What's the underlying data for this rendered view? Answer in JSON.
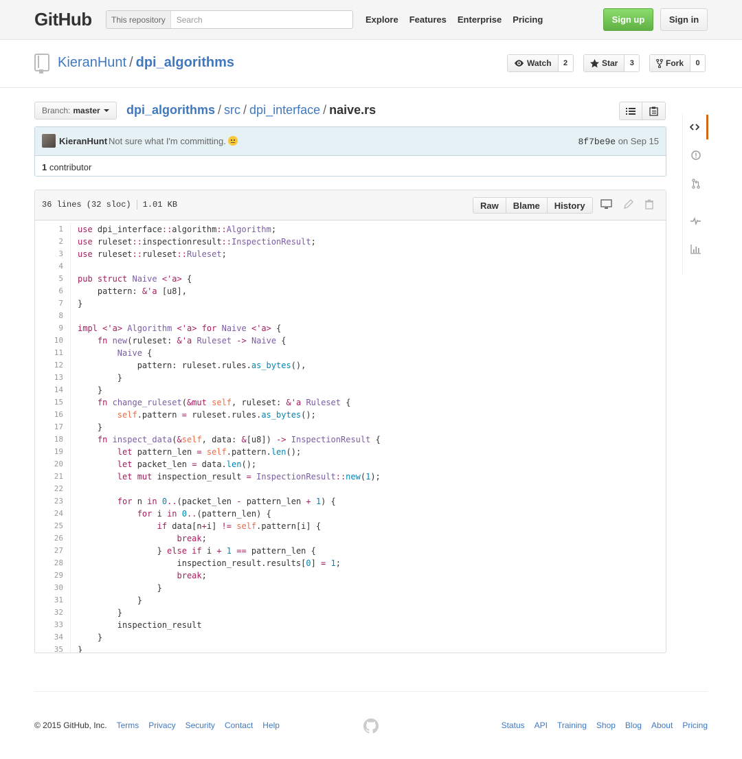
{
  "header": {
    "logo": "GitHub",
    "search_scope": "This repository",
    "search_placeholder": "Search",
    "nav": [
      "Explore",
      "Features",
      "Enterprise",
      "Pricing"
    ],
    "signup": "Sign up",
    "signin": "Sign in"
  },
  "repo": {
    "owner": "KieranHunt",
    "separator": "/",
    "name": "dpi_algorithms",
    "watch_label": "Watch",
    "watch_count": "2",
    "star_label": "Star",
    "star_count": "3",
    "fork_label": "Fork",
    "fork_count": "0"
  },
  "file_nav": {
    "branch_label": "Branch:",
    "branch": "master",
    "breadcrumb": [
      "dpi_algorithms",
      "src",
      "dpi_interface"
    ],
    "filename": "naive.rs"
  },
  "commit": {
    "author": "KieranHunt",
    "message": "Not sure what I'm committing.",
    "sha": "8f7be9e",
    "date_prefix": "on",
    "date": "Sep 15",
    "contributors_count": "1",
    "contributors_label": "contributor"
  },
  "file": {
    "lines_info": "36 lines (32 sloc)",
    "size": "1.01 KB",
    "raw": "Raw",
    "blame": "Blame",
    "history": "History",
    "code": [
      [
        [
          "k",
          "use"
        ],
        [
          "",
          "dpi_interface"
        ],
        [
          "k",
          "::"
        ],
        [
          "",
          "algorithm"
        ],
        [
          "k",
          "::"
        ],
        [
          "t",
          "Algorithm"
        ],
        [
          "",
          ";"
        ]
      ],
      [
        [
          "k",
          "use"
        ],
        [
          "",
          "ruleset"
        ],
        [
          "k",
          "::"
        ],
        [
          "",
          "inspectionresult"
        ],
        [
          "k",
          "::"
        ],
        [
          "t",
          "InspectionResult"
        ],
        [
          "",
          ";"
        ]
      ],
      [
        [
          "k",
          "use"
        ],
        [
          "",
          "ruleset"
        ],
        [
          "k",
          "::"
        ],
        [
          "",
          "ruleset"
        ],
        [
          "k",
          "::"
        ],
        [
          "t",
          "Ruleset"
        ],
        [
          "",
          ";"
        ]
      ],
      [],
      [
        [
          "k",
          "pub struct"
        ],
        [
          "",
          ""
        ],
        [
          "t",
          "Naive"
        ],
        [
          "",
          ""
        ],
        [
          "k",
          "<'a>"
        ],
        [
          "",
          " {"
        ]
      ],
      [
        [
          "",
          "    pattern: "
        ],
        [
          "k",
          "&'a"
        ],
        [
          "",
          " [u8],"
        ]
      ],
      [
        [
          "",
          "}"
        ]
      ],
      [],
      [
        [
          "k",
          "impl"
        ],
        [
          "",
          ""
        ],
        [
          "k",
          "<'a>"
        ],
        [
          "",
          ""
        ],
        [
          "t",
          "Algorithm"
        ],
        [
          "",
          ""
        ],
        [
          "k",
          "<'a>"
        ],
        [
          "",
          ""
        ],
        [
          "k",
          "for"
        ],
        [
          "",
          ""
        ],
        [
          "t",
          "Naive"
        ],
        [
          "",
          ""
        ],
        [
          "k",
          "<'a>"
        ],
        [
          "",
          " {"
        ]
      ],
      [
        [
          "",
          "    "
        ],
        [
          "k",
          "fn"
        ],
        [
          "",
          ""
        ],
        [
          "t",
          "new"
        ],
        [
          "",
          "(ruleset: "
        ],
        [
          "k",
          "&'a"
        ],
        [
          "",
          ""
        ],
        [
          "t",
          "Ruleset"
        ],
        [
          "",
          " "
        ],
        [
          "k",
          "->"
        ],
        [
          "",
          ""
        ],
        [
          "t",
          "Naive"
        ],
        [
          "",
          " {"
        ]
      ],
      [
        [
          "",
          "        "
        ],
        [
          "t",
          "Naive"
        ],
        [
          "",
          " {"
        ]
      ],
      [
        [
          "",
          "            pattern: ruleset.rules."
        ],
        [
          "f",
          "as_bytes"
        ],
        [
          "",
          "(),"
        ]
      ],
      [
        [
          "",
          "        }"
        ]
      ],
      [
        [
          "",
          "    }"
        ]
      ],
      [
        [
          "",
          "    "
        ],
        [
          "k",
          "fn"
        ],
        [
          "",
          ""
        ],
        [
          "t",
          "change_ruleset"
        ],
        [
          "",
          "("
        ],
        [
          "k",
          "&mut"
        ],
        [
          "",
          ""
        ],
        [
          "s",
          "self"
        ],
        [
          "",
          ", ruleset: "
        ],
        [
          "k",
          "&'a"
        ],
        [
          "",
          ""
        ],
        [
          "t",
          "Ruleset"
        ],
        [
          "",
          " {"
        ]
      ],
      [
        [
          "",
          "        "
        ],
        [
          "s",
          "self"
        ],
        [
          "",
          ".pattern "
        ],
        [
          "k",
          "="
        ],
        [
          "",
          " ruleset.rules."
        ],
        [
          "f",
          "as_bytes"
        ],
        [
          "",
          "();"
        ]
      ],
      [
        [
          "",
          "    }"
        ]
      ],
      [
        [
          "",
          "    "
        ],
        [
          "k",
          "fn"
        ],
        [
          "",
          ""
        ],
        [
          "t",
          "inspect_data"
        ],
        [
          "",
          "("
        ],
        [
          "k",
          "&"
        ],
        [
          "s",
          "self"
        ],
        [
          "",
          ", data: "
        ],
        [
          "k",
          "&"
        ],
        [
          "",
          "[u8]) "
        ],
        [
          "k",
          "->"
        ],
        [
          "",
          ""
        ],
        [
          "t",
          "InspectionResult"
        ],
        [
          "",
          " {"
        ]
      ],
      [
        [
          "",
          "        "
        ],
        [
          "k",
          "let"
        ],
        [
          "",
          " pattern_len "
        ],
        [
          "k",
          "="
        ],
        [
          "",
          ""
        ],
        [
          "s",
          "self"
        ],
        [
          "",
          ".pattern."
        ],
        [
          "f",
          "len"
        ],
        [
          "",
          "();"
        ]
      ],
      [
        [
          "",
          "        "
        ],
        [
          "k",
          "let"
        ],
        [
          "",
          " packet_len "
        ],
        [
          "k",
          "="
        ],
        [
          "",
          " data."
        ],
        [
          "f",
          "len"
        ],
        [
          "",
          "();"
        ]
      ],
      [
        [
          "",
          "        "
        ],
        [
          "k",
          "let mut"
        ],
        [
          "",
          " inspection_result "
        ],
        [
          "k",
          "="
        ],
        [
          "",
          ""
        ],
        [
          "t",
          "InspectionResult"
        ],
        [
          "k",
          "::"
        ],
        [
          "f",
          "new"
        ],
        [
          "",
          "("
        ],
        [
          "n",
          "1"
        ],
        [
          "",
          ");"
        ]
      ],
      [],
      [
        [
          "",
          "        "
        ],
        [
          "k",
          "for"
        ],
        [
          "",
          " n "
        ],
        [
          "k",
          "in"
        ],
        [
          "",
          ""
        ],
        [
          "n",
          "0"
        ],
        [
          "k",
          ".."
        ],
        [
          "",
          "(packet_len "
        ],
        [
          "k",
          "-"
        ],
        [
          "",
          " pattern_len "
        ],
        [
          "k",
          "+"
        ],
        [
          "",
          ""
        ],
        [
          "n",
          "1"
        ],
        [
          "",
          ") {"
        ]
      ],
      [
        [
          "",
          "            "
        ],
        [
          "k",
          "for"
        ],
        [
          "",
          " i "
        ],
        [
          "k",
          "in"
        ],
        [
          "",
          ""
        ],
        [
          "n",
          "0"
        ],
        [
          "k",
          ".."
        ],
        [
          "",
          "(pattern_len) {"
        ]
      ],
      [
        [
          "",
          "                "
        ],
        [
          "k",
          "if"
        ],
        [
          "",
          " data[n"
        ],
        [
          "k",
          "+"
        ],
        [
          "",
          "i] "
        ],
        [
          "k",
          "!="
        ],
        [
          "",
          ""
        ],
        [
          "s",
          "self"
        ],
        [
          "",
          ".pattern[i] {"
        ]
      ],
      [
        [
          "",
          "                    "
        ],
        [
          "k",
          "break"
        ],
        [
          "",
          ";"
        ]
      ],
      [
        [
          "",
          "                } "
        ],
        [
          "k",
          "else if"
        ],
        [
          "",
          " i "
        ],
        [
          "k",
          "+"
        ],
        [
          "",
          ""
        ],
        [
          "n",
          "1"
        ],
        [
          "",
          " "
        ],
        [
          "k",
          "=="
        ],
        [
          "",
          " pattern_len {"
        ]
      ],
      [
        [
          "",
          "                    inspection_result.results["
        ],
        [
          "n",
          "0"
        ],
        [
          "",
          "] "
        ],
        [
          "k",
          "="
        ],
        [
          "",
          ""
        ],
        [
          "n",
          "1"
        ],
        [
          "",
          ";"
        ]
      ],
      [
        [
          "",
          "                    "
        ],
        [
          "k",
          "break"
        ],
        [
          "",
          ";"
        ]
      ],
      [
        [
          "",
          "                }"
        ]
      ],
      [
        [
          "",
          "            }"
        ]
      ],
      [
        [
          "",
          "        }"
        ]
      ],
      [
        [
          "",
          "        inspection_result"
        ]
      ],
      [
        [
          "",
          "    }"
        ]
      ],
      [
        [
          "",
          "}"
        ]
      ]
    ]
  },
  "sidebar": {
    "items": [
      "code-icon",
      "issues-icon",
      "pull-requests-icon",
      "pulse-icon",
      "graphs-icon"
    ],
    "accent": "#d26911"
  },
  "footer": {
    "copyright": "© 2015 GitHub, Inc.",
    "left_links": [
      "Terms",
      "Privacy",
      "Security",
      "Contact",
      "Help"
    ],
    "right_links": [
      "Status",
      "API",
      "Training",
      "Shop",
      "Blog",
      "About",
      "Pricing"
    ]
  },
  "colors": {
    "link": "#4078c0",
    "signup_green": "#60b044",
    "keyword": "#a71d5d",
    "type": "#795da3",
    "function": "#0086b3",
    "self": "#ed6a43"
  }
}
